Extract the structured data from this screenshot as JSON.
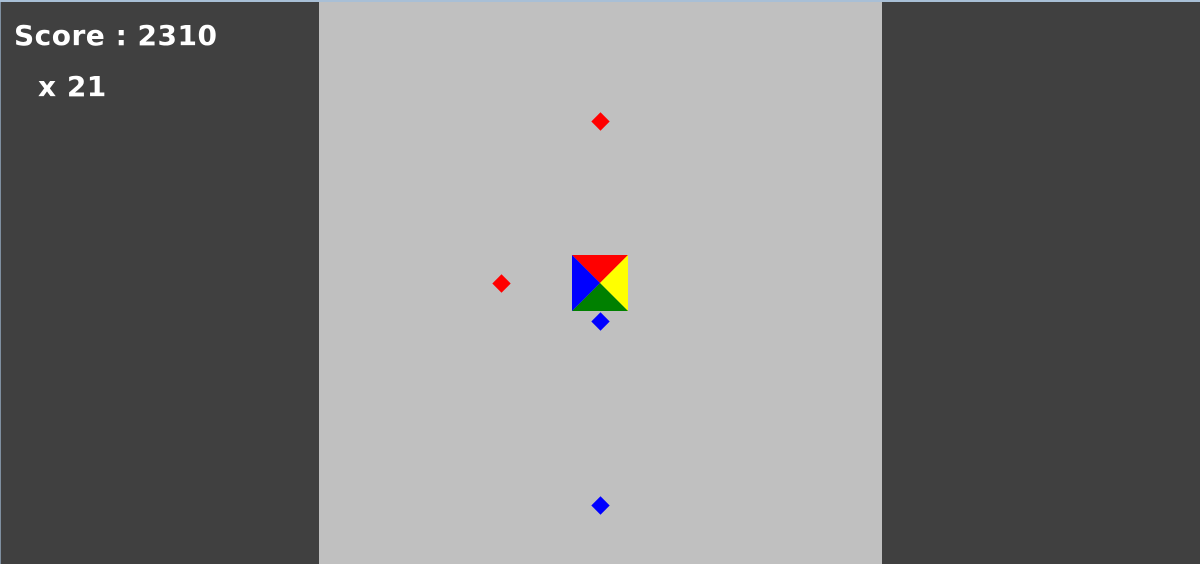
{
  "hud": {
    "score_label": "Score",
    "score_separator": ":",
    "score_value": "2310",
    "multiplier_symbol": "x",
    "multiplier_value": "21"
  },
  "colors": {
    "background_dark": "#404040",
    "playfield": "#c0c0c0",
    "hud_text": "#ffffff",
    "red": "#ff0000",
    "blue": "#0000ff",
    "green": "#008000",
    "yellow": "#ffff00"
  },
  "player": {
    "quadrants": [
      "red",
      "yellow",
      "green",
      "blue"
    ]
  },
  "pickups": [
    {
      "name": "pickup-red-top",
      "color": "red"
    },
    {
      "name": "pickup-red-left",
      "color": "red"
    },
    {
      "name": "pickup-blue-near",
      "color": "blue"
    },
    {
      "name": "pickup-blue-bottom",
      "color": "blue"
    }
  ]
}
